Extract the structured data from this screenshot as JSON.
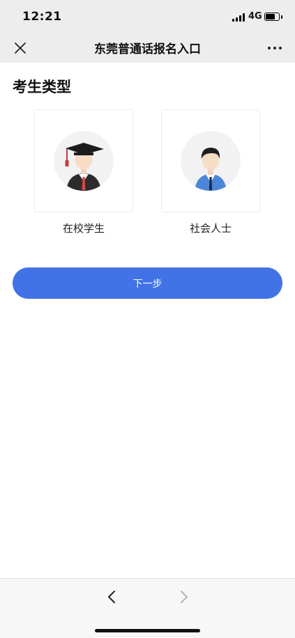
{
  "status_bar": {
    "time": "12:21",
    "network": "4G",
    "icons": [
      "signal-icon",
      "battery-icon"
    ]
  },
  "nav": {
    "title": "东莞普通话报名入口",
    "close_icon": "close-icon",
    "more_icon": "more-icon"
  },
  "section": {
    "title": "考生类型"
  },
  "candidate_types": [
    {
      "label": "在校学生",
      "icon": "graduate-avatar-icon"
    },
    {
      "label": "社会人士",
      "icon": "professional-avatar-icon"
    }
  ],
  "actions": {
    "next_label": "下一步"
  },
  "toolbar": {
    "back_icon": "chevron-left-icon",
    "forward_icon": "chevron-right-icon"
  },
  "colors": {
    "accent": "#4273e6",
    "header_bg": "#ededed",
    "toolbar_bg": "#f7f7f7"
  }
}
